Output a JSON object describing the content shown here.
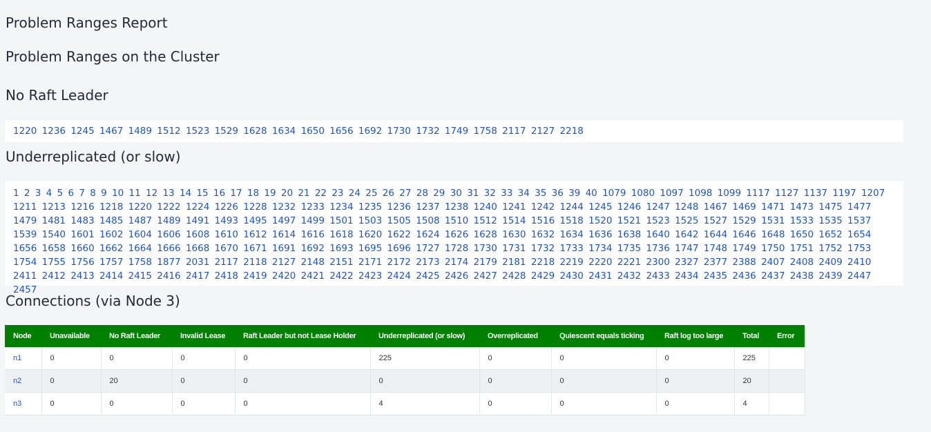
{
  "page": {
    "report_title": "Problem Ranges Report",
    "cluster_title": "Problem Ranges on the Cluster",
    "no_raft_leader_heading": "No Raft Leader",
    "underreplicated_heading": "Underreplicated (or slow)",
    "connections_heading": "Connections (via Node 3)"
  },
  "no_raft_leader_ranges": [
    "1220",
    "1236",
    "1245",
    "1467",
    "1489",
    "1512",
    "1523",
    "1529",
    "1628",
    "1634",
    "1650",
    "1656",
    "1692",
    "1730",
    "1732",
    "1749",
    "1758",
    "2117",
    "2127",
    "2218"
  ],
  "underreplicated_ranges": [
    "1",
    "2",
    "3",
    "4",
    "5",
    "6",
    "7",
    "8",
    "9",
    "10",
    "11",
    "12",
    "13",
    "14",
    "15",
    "16",
    "17",
    "18",
    "19",
    "20",
    "21",
    "22",
    "23",
    "24",
    "25",
    "26",
    "27",
    "28",
    "29",
    "30",
    "31",
    "32",
    "33",
    "34",
    "35",
    "36",
    "39",
    "40",
    "1079",
    "1080",
    "1097",
    "1098",
    "1099",
    "1117",
    "1127",
    "1137",
    "1197",
    "1207",
    "1211",
    "1213",
    "1216",
    "1218",
    "1220",
    "1222",
    "1224",
    "1226",
    "1228",
    "1232",
    "1233",
    "1234",
    "1235",
    "1236",
    "1237",
    "1238",
    "1240",
    "1241",
    "1242",
    "1244",
    "1245",
    "1246",
    "1247",
    "1248",
    "1467",
    "1469",
    "1471",
    "1473",
    "1475",
    "1477",
    "1479",
    "1481",
    "1483",
    "1485",
    "1487",
    "1489",
    "1491",
    "1493",
    "1495",
    "1497",
    "1499",
    "1501",
    "1503",
    "1505",
    "1508",
    "1510",
    "1512",
    "1514",
    "1516",
    "1518",
    "1520",
    "1521",
    "1523",
    "1525",
    "1527",
    "1529",
    "1531",
    "1533",
    "1535",
    "1537",
    "1539",
    "1540",
    "1601",
    "1602",
    "1604",
    "1606",
    "1608",
    "1610",
    "1612",
    "1614",
    "1616",
    "1618",
    "1620",
    "1622",
    "1624",
    "1626",
    "1628",
    "1630",
    "1632",
    "1634",
    "1636",
    "1638",
    "1640",
    "1642",
    "1644",
    "1646",
    "1648",
    "1650",
    "1652",
    "1654",
    "1656",
    "1658",
    "1660",
    "1662",
    "1664",
    "1666",
    "1668",
    "1670",
    "1671",
    "1691",
    "1692",
    "1693",
    "1695",
    "1696",
    "1727",
    "1728",
    "1730",
    "1731",
    "1732",
    "1733",
    "1734",
    "1735",
    "1736",
    "1747",
    "1748",
    "1749",
    "1750",
    "1751",
    "1752",
    "1753",
    "1754",
    "1755",
    "1756",
    "1757",
    "1758",
    "1877",
    "2031",
    "2117",
    "2118",
    "2127",
    "2148",
    "2151",
    "2171",
    "2172",
    "2173",
    "2174",
    "2179",
    "2181",
    "2218",
    "2219",
    "2220",
    "2221",
    "2300",
    "2327",
    "2377",
    "2388",
    "2407",
    "2408",
    "2409",
    "2410",
    "2411",
    "2412",
    "2413",
    "2414",
    "2415",
    "2416",
    "2417",
    "2418",
    "2419",
    "2420",
    "2421",
    "2422",
    "2423",
    "2424",
    "2425",
    "2426",
    "2427",
    "2428",
    "2429",
    "2430",
    "2431",
    "2432",
    "2433",
    "2434",
    "2435",
    "2436",
    "2437",
    "2438",
    "2439",
    "2447",
    "2457"
  ],
  "connections": {
    "columns": [
      "Node",
      "Unavailable",
      "No Raft Leader",
      "Invalid Lease",
      "Raft Leader but not Lease Holder",
      "Underreplicated (or slow)",
      "Overreplicated",
      "Quiescent equals ticking",
      "Raft log too large",
      "Total",
      "Error"
    ],
    "rows": [
      [
        "n1",
        "0",
        "0",
        "0",
        "0",
        "225",
        "0",
        "0",
        "0",
        "225",
        ""
      ],
      [
        "n2",
        "0",
        "20",
        "0",
        "0",
        "0",
        "0",
        "0",
        "0",
        "20",
        ""
      ],
      [
        "n3",
        "0",
        "0",
        "0",
        "0",
        "4",
        "0",
        "0",
        "0",
        "4",
        ""
      ]
    ]
  }
}
